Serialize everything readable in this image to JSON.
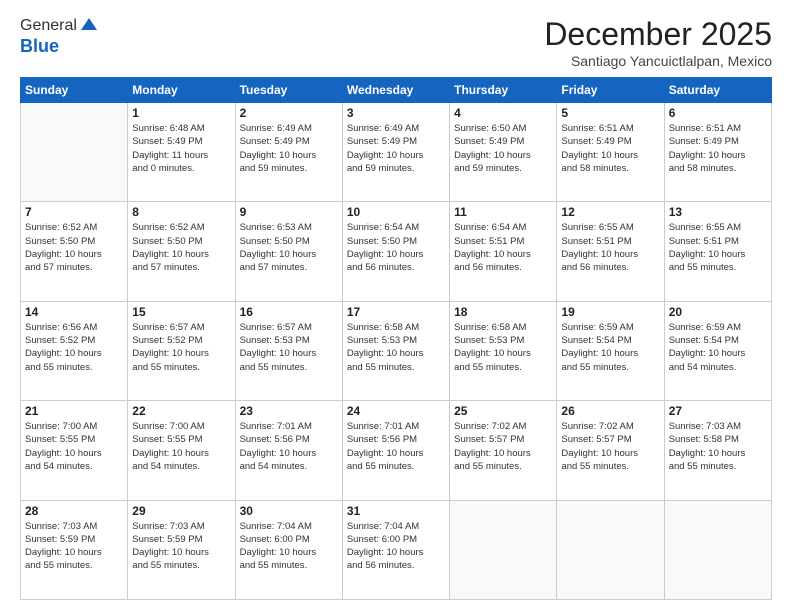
{
  "logo": {
    "general": "General",
    "blue": "Blue"
  },
  "header": {
    "month": "December 2025",
    "location": "Santiago Yancuictlalpan, Mexico"
  },
  "weekdays": [
    "Sunday",
    "Monday",
    "Tuesday",
    "Wednesday",
    "Thursday",
    "Friday",
    "Saturday"
  ],
  "weeks": [
    [
      {
        "day": "",
        "info": ""
      },
      {
        "day": "1",
        "info": "Sunrise: 6:48 AM\nSunset: 5:49 PM\nDaylight: 11 hours\nand 0 minutes."
      },
      {
        "day": "2",
        "info": "Sunrise: 6:49 AM\nSunset: 5:49 PM\nDaylight: 10 hours\nand 59 minutes."
      },
      {
        "day": "3",
        "info": "Sunrise: 6:49 AM\nSunset: 5:49 PM\nDaylight: 10 hours\nand 59 minutes."
      },
      {
        "day": "4",
        "info": "Sunrise: 6:50 AM\nSunset: 5:49 PM\nDaylight: 10 hours\nand 59 minutes."
      },
      {
        "day": "5",
        "info": "Sunrise: 6:51 AM\nSunset: 5:49 PM\nDaylight: 10 hours\nand 58 minutes."
      },
      {
        "day": "6",
        "info": "Sunrise: 6:51 AM\nSunset: 5:49 PM\nDaylight: 10 hours\nand 58 minutes."
      }
    ],
    [
      {
        "day": "7",
        "info": "Sunrise: 6:52 AM\nSunset: 5:50 PM\nDaylight: 10 hours\nand 57 minutes."
      },
      {
        "day": "8",
        "info": "Sunrise: 6:52 AM\nSunset: 5:50 PM\nDaylight: 10 hours\nand 57 minutes."
      },
      {
        "day": "9",
        "info": "Sunrise: 6:53 AM\nSunset: 5:50 PM\nDaylight: 10 hours\nand 57 minutes."
      },
      {
        "day": "10",
        "info": "Sunrise: 6:54 AM\nSunset: 5:50 PM\nDaylight: 10 hours\nand 56 minutes."
      },
      {
        "day": "11",
        "info": "Sunrise: 6:54 AM\nSunset: 5:51 PM\nDaylight: 10 hours\nand 56 minutes."
      },
      {
        "day": "12",
        "info": "Sunrise: 6:55 AM\nSunset: 5:51 PM\nDaylight: 10 hours\nand 56 minutes."
      },
      {
        "day": "13",
        "info": "Sunrise: 6:55 AM\nSunset: 5:51 PM\nDaylight: 10 hours\nand 55 minutes."
      }
    ],
    [
      {
        "day": "14",
        "info": "Sunrise: 6:56 AM\nSunset: 5:52 PM\nDaylight: 10 hours\nand 55 minutes."
      },
      {
        "day": "15",
        "info": "Sunrise: 6:57 AM\nSunset: 5:52 PM\nDaylight: 10 hours\nand 55 minutes."
      },
      {
        "day": "16",
        "info": "Sunrise: 6:57 AM\nSunset: 5:53 PM\nDaylight: 10 hours\nand 55 minutes."
      },
      {
        "day": "17",
        "info": "Sunrise: 6:58 AM\nSunset: 5:53 PM\nDaylight: 10 hours\nand 55 minutes."
      },
      {
        "day": "18",
        "info": "Sunrise: 6:58 AM\nSunset: 5:53 PM\nDaylight: 10 hours\nand 55 minutes."
      },
      {
        "day": "19",
        "info": "Sunrise: 6:59 AM\nSunset: 5:54 PM\nDaylight: 10 hours\nand 55 minutes."
      },
      {
        "day": "20",
        "info": "Sunrise: 6:59 AM\nSunset: 5:54 PM\nDaylight: 10 hours\nand 54 minutes."
      }
    ],
    [
      {
        "day": "21",
        "info": "Sunrise: 7:00 AM\nSunset: 5:55 PM\nDaylight: 10 hours\nand 54 minutes."
      },
      {
        "day": "22",
        "info": "Sunrise: 7:00 AM\nSunset: 5:55 PM\nDaylight: 10 hours\nand 54 minutes."
      },
      {
        "day": "23",
        "info": "Sunrise: 7:01 AM\nSunset: 5:56 PM\nDaylight: 10 hours\nand 54 minutes."
      },
      {
        "day": "24",
        "info": "Sunrise: 7:01 AM\nSunset: 5:56 PM\nDaylight: 10 hours\nand 55 minutes."
      },
      {
        "day": "25",
        "info": "Sunrise: 7:02 AM\nSunset: 5:57 PM\nDaylight: 10 hours\nand 55 minutes."
      },
      {
        "day": "26",
        "info": "Sunrise: 7:02 AM\nSunset: 5:57 PM\nDaylight: 10 hours\nand 55 minutes."
      },
      {
        "day": "27",
        "info": "Sunrise: 7:03 AM\nSunset: 5:58 PM\nDaylight: 10 hours\nand 55 minutes."
      }
    ],
    [
      {
        "day": "28",
        "info": "Sunrise: 7:03 AM\nSunset: 5:59 PM\nDaylight: 10 hours\nand 55 minutes."
      },
      {
        "day": "29",
        "info": "Sunrise: 7:03 AM\nSunset: 5:59 PM\nDaylight: 10 hours\nand 55 minutes."
      },
      {
        "day": "30",
        "info": "Sunrise: 7:04 AM\nSunset: 6:00 PM\nDaylight: 10 hours\nand 55 minutes."
      },
      {
        "day": "31",
        "info": "Sunrise: 7:04 AM\nSunset: 6:00 PM\nDaylight: 10 hours\nand 56 minutes."
      },
      {
        "day": "",
        "info": ""
      },
      {
        "day": "",
        "info": ""
      },
      {
        "day": "",
        "info": ""
      }
    ]
  ]
}
